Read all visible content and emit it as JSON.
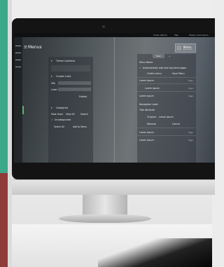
{
  "screen": {
    "topbar": {
      "left": "Screen Options",
      "middle": "Help",
      "right": "Howdy, Lorem Ipsum"
    },
    "page_title": "Menus",
    "left_panel": {
      "theme_locations": "Theme Locations",
      "custom_links": "Custom Links",
      "url_label": "URL",
      "label_label": "Label",
      "publish": "Publish",
      "categories": "Categories",
      "most_used": "Most Used",
      "view_all": "View All",
      "search": "Search",
      "uncategorized": "Uncategorized",
      "select_all": "Select All",
      "add_to_menu": "Add to Menu"
    },
    "right_panel": {
      "tab_main": "Main",
      "menu_name": "Menu Name",
      "auto_add": "Automatically add new top-level pages",
      "create_menu": "Create menu",
      "save_menu": "Save Menu",
      "item_label": "Lorem ipsum",
      "item_type": "Page",
      "navigation_label": "Navigation Label",
      "title_attribute": "Title Attribute",
      "original": "Original:",
      "original_value": "Lorem ipsum",
      "remove": "Remove",
      "cancel": "Cancel"
    },
    "brand": {
      "title": "Metro",
      "subtitle": "Admin theme"
    }
  }
}
